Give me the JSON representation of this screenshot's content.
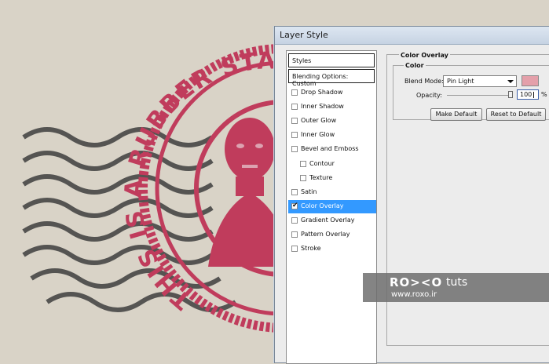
{
  "colors": {
    "stamp": "#c03c5c",
    "postmark": "#3e3e3e",
    "paper": "#d9d3c7",
    "selection": "#3399ff",
    "overlay_swatch": "#e4a0aa"
  },
  "artwork": {
    "stamp_text": "THIS IS A RUBBER STAMP"
  },
  "dialog": {
    "title": "Layer Style",
    "styles_header": "Styles",
    "blending_header": "Blending Options: Custom",
    "style_items": [
      {
        "label": "Drop Shadow",
        "checked": false,
        "selected": false,
        "indent": false
      },
      {
        "label": "Inner Shadow",
        "checked": false,
        "selected": false,
        "indent": false
      },
      {
        "label": "Outer Glow",
        "checked": false,
        "selected": false,
        "indent": false
      },
      {
        "label": "Inner Glow",
        "checked": false,
        "selected": false,
        "indent": false
      },
      {
        "label": "Bevel and Emboss",
        "checked": false,
        "selected": false,
        "indent": false
      },
      {
        "label": "Contour",
        "checked": false,
        "selected": false,
        "indent": true
      },
      {
        "label": "Texture",
        "checked": false,
        "selected": false,
        "indent": true
      },
      {
        "label": "Satin",
        "checked": false,
        "selected": false,
        "indent": false
      },
      {
        "label": "Color Overlay",
        "checked": true,
        "selected": true,
        "indent": false
      },
      {
        "label": "Gradient Overlay",
        "checked": false,
        "selected": false,
        "indent": false
      },
      {
        "label": "Pattern Overlay",
        "checked": false,
        "selected": false,
        "indent": false
      },
      {
        "label": "Stroke",
        "checked": false,
        "selected": false,
        "indent": false
      }
    ],
    "panel_title": "Color Overlay",
    "color_group_title": "Color",
    "blend_mode_label": "Blend Mode:",
    "blend_mode_value": "Pin Light",
    "opacity_label": "Opacity:",
    "opacity_value": "100",
    "opacity_fraction": 1.0,
    "percent_sign": "%",
    "make_default_label": "Make Default",
    "reset_default_label": "Reset to Default"
  },
  "watermark": {
    "logo": "RO><O",
    "tuts": "tuts",
    "url": "www.roxo.ir"
  }
}
